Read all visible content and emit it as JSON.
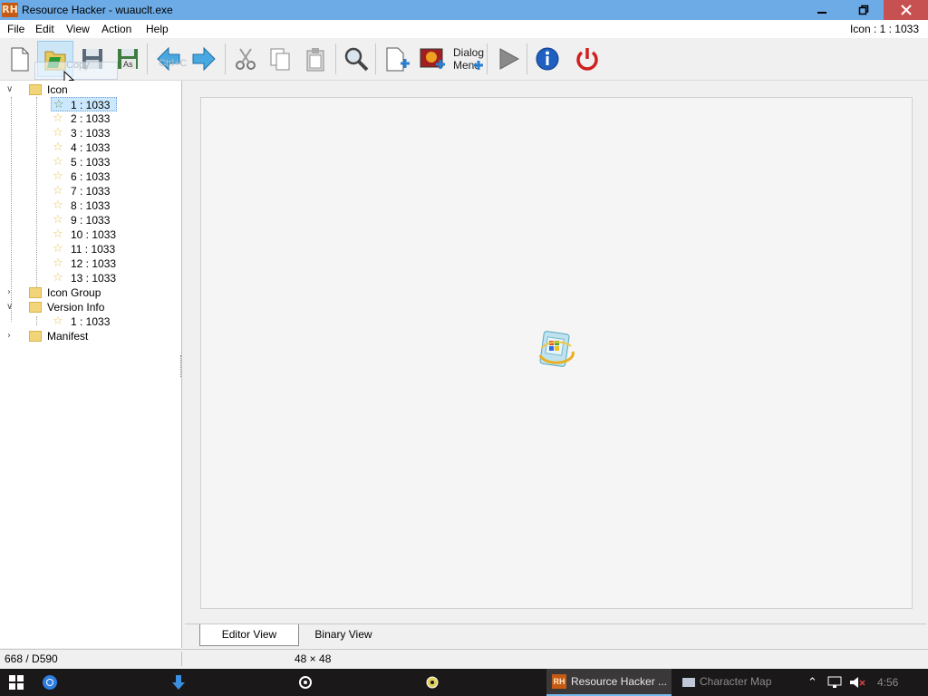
{
  "window": {
    "logo": "RH",
    "title": "Resource Hacker - wuauclt.exe",
    "minimize_icon": "minimize-icon",
    "restore_icon": "restore-icon",
    "close_icon": "close-icon"
  },
  "menu": {
    "items": [
      "File",
      "Edit",
      "View",
      "Action",
      "Help"
    ],
    "status": "Icon : 1 : 1033"
  },
  "toolbar": {
    "buttons": [
      "new-file-icon",
      "open-file-icon",
      "save-icon",
      "save-as-icon",
      "compile-left-icon",
      "compile-right-icon",
      "cut-icon",
      "copy-icon",
      "paste-icon",
      "find-icon",
      "add-resource-icon",
      "add-image-icon",
      "dialog-menu-icon",
      "run-icon",
      "info-icon",
      "power-icon"
    ],
    "save_as_label": "As",
    "dialog_label_1": "Dialog",
    "dialog_label_2": "Menu",
    "tooltip_ghost_1": "Copy",
    "tooltip_ghost_2": "Ctrl+C"
  },
  "tree": {
    "icon_group_root": "Icon",
    "icon_items": [
      "1 : 1033",
      "2 : 1033",
      "3 : 1033",
      "4 : 1033",
      "5 : 1033",
      "6 : 1033",
      "7 : 1033",
      "8 : 1033",
      "9 : 1033",
      "10 : 1033",
      "11 : 1033",
      "12 : 1033",
      "13 : 1033"
    ],
    "icon_group": "Icon Group",
    "version_info": "Version Info",
    "version_items": [
      "1 : 1033"
    ],
    "manifest": "Manifest"
  },
  "tabs": {
    "editor": "Editor View",
    "binary": "Binary View"
  },
  "status": {
    "offset": "668 / D590",
    "size": "48 × 48"
  },
  "taskbar": {
    "resource_hacker": "Resource Hacker ...",
    "other_app": "Character Map",
    "time": "4:56"
  }
}
